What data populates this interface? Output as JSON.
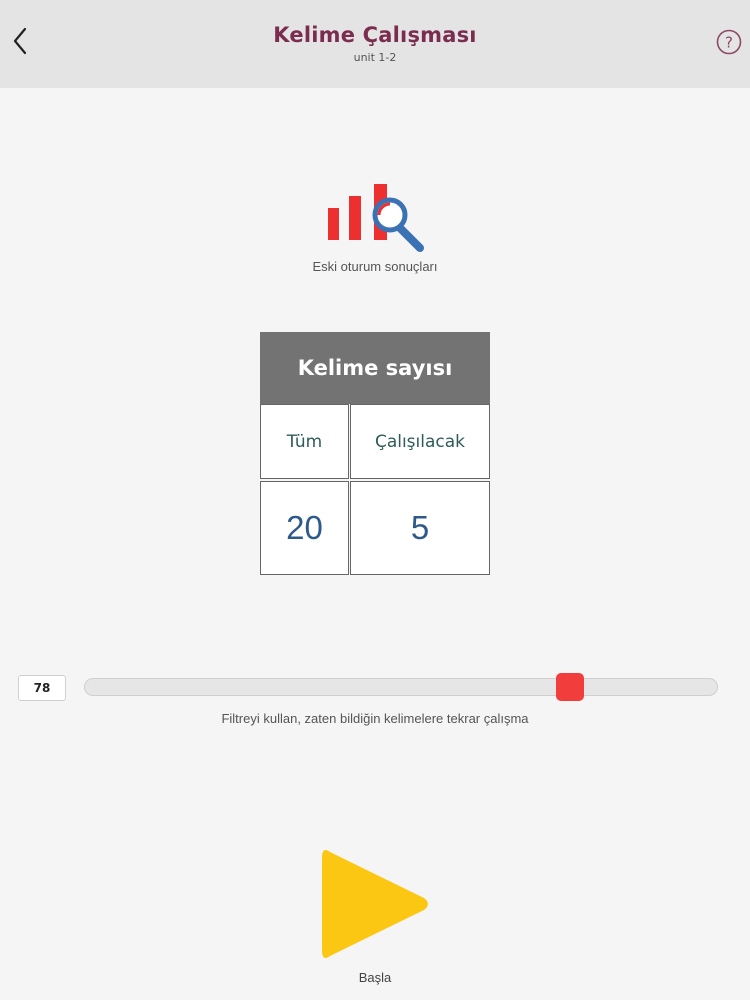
{
  "header": {
    "title": "Kelime Çalışması",
    "subtitle": "unit 1-2",
    "back_icon": "chevron-left-icon",
    "help_icon": "question-circle-icon"
  },
  "results": {
    "icon": "bar-chart-magnifier-icon",
    "label": "Eski oturum sonuçları"
  },
  "word_count": {
    "header": "Kelime sayısı",
    "columns": [
      {
        "label": "Tüm",
        "value": "20"
      },
      {
        "label": "Çalışılacak",
        "value": "5"
      }
    ]
  },
  "filter": {
    "value": "78",
    "min": 0,
    "max": 100,
    "caption": "Filtreyi kullan, zaten bildiğin kelimelere tekrar çalışma"
  },
  "start": {
    "icon": "play-icon",
    "label": "Başla"
  },
  "colors": {
    "title": "#7a2d4e",
    "slider_thumb": "#f23d3d",
    "play_button": "#fcc712",
    "chart_bars": "#ee2f2f",
    "magnifier": "#3a72b4",
    "count_value": "#2d5a8a"
  }
}
